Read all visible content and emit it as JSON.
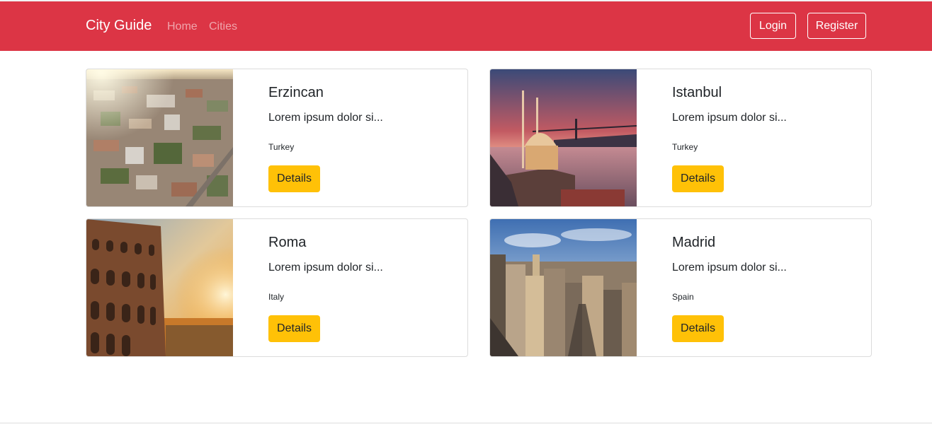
{
  "navbar": {
    "brand": "City Guide",
    "links": [
      "Home",
      "Cities"
    ],
    "login_label": "Login",
    "register_label": "Register",
    "color": "#dc3545"
  },
  "cards": [
    {
      "title": "Erzincan",
      "text": "Lorem ipsum dolor si...",
      "country": "Turkey",
      "details_label": "Details",
      "image": "aerial-city-photo"
    },
    {
      "title": "Istanbul",
      "text": "Lorem ipsum dolor si...",
      "country": "Turkey",
      "details_label": "Details",
      "image": "mosque-sunset-photo"
    },
    {
      "title": "Roma",
      "text": "Lorem ipsum dolor si...",
      "country": "Italy",
      "details_label": "Details",
      "image": "colosseum-sunset-photo"
    },
    {
      "title": "Madrid",
      "text": "Lorem ipsum dolor si...",
      "country": "Spain",
      "details_label": "Details",
      "image": "city-skyline-photo"
    }
  ],
  "colors": {
    "accent": "#dc3545",
    "button": "#ffc107"
  }
}
